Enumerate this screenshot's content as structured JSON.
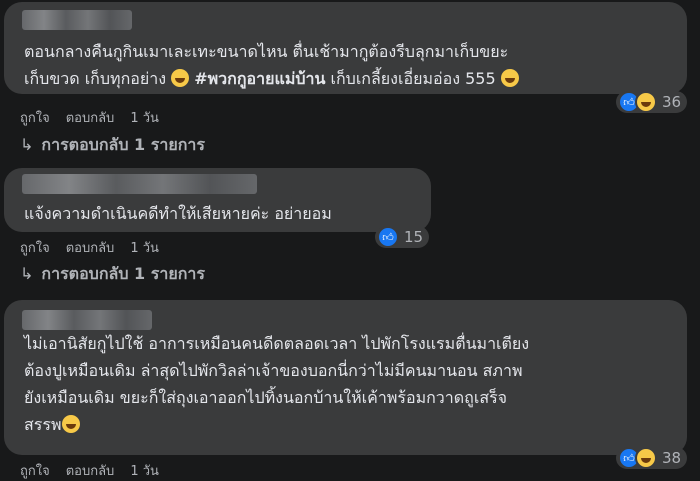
{
  "comments": [
    {
      "text_before": "ตอนกลางคืนกูกินเมาเละเทะขนาดไหน ตื่นเช้ามากูต้องรีบลุกมาเก็บขยะ\nเก็บขวด เก็บทุกอย่าง ",
      "hashtag": "#พวกกูอายแม่บ้าน",
      "text_after": " เก็บเกลี้ยงเอี่ยมอ่อง 555 ",
      "like": "ถูกใจ",
      "reply": "ตอบกลับ",
      "time": "1 วัน",
      "reaction_count": "36",
      "replies_link": "การตอบกลับ 1 รายการ"
    },
    {
      "text": "แจ้งความดำเนินคดีทำให้เสียหายค่ะ อย่ายอม",
      "like": "ถูกใจ",
      "reply": "ตอบกลับ",
      "time": "1 วัน",
      "reaction_count": "15",
      "replies_link": "การตอบกลับ 1 รายการ"
    },
    {
      "text": "ไม่เอานิสัยกูไปใช้ อาการเหมือนคนดีดตลอดเวลา ไปพักโรงแรมตื่นมาเตียง\nต้องปูเหมือนเดิม ล่าสุดไปพักวิลล่าเจ้าของบอกนี่กว่าไม่มีคนมานอน สภาพ\nยังเหมือนเดิม ขยะก็ใส่ถุงเอาออกไปทิ้งนอกบ้านให้เค้าพร้อมกวาดถูเสร็จ\nสรรพ",
      "like": "ถูกใจ",
      "reply": "ตอบกลับ",
      "time": "1 วัน",
      "reaction_count": "38"
    }
  ],
  "icons": {
    "reply_arrow": "↳",
    "like_icon": "👍"
  },
  "colors": {
    "background": "#18191a",
    "bubble": "#3a3b3c",
    "like_blue": "#1877f2",
    "haha_yellow": "#f7c948"
  }
}
